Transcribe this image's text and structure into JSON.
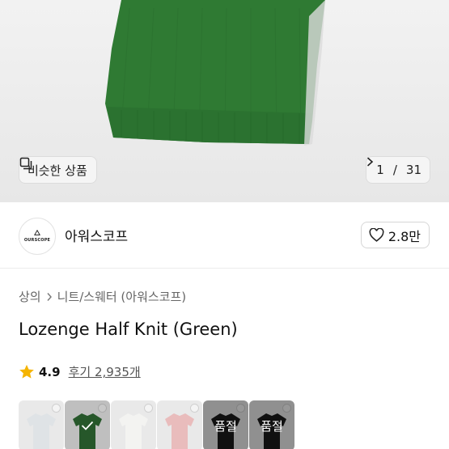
{
  "hero": {
    "similar_label": "비슷한 상품",
    "counter": {
      "current": "1",
      "separator": "/",
      "total": "31"
    }
  },
  "brand": {
    "logo_text": "OURSCOPE",
    "name": "아워스코프",
    "likes": "2.8만"
  },
  "breadcrumb": {
    "level1": "상의",
    "level2": "니트/스웨터 (아워스코프)"
  },
  "product": {
    "title": "Lozenge Half Knit (Green)",
    "rating": "4.9",
    "reviews_label": "후기 2,935개"
  },
  "swatches": [
    {
      "color": "#dfe3e6",
      "status": "",
      "selected": false
    },
    {
      "color": "#2f6b34",
      "status": "",
      "selected": true
    },
    {
      "color": "#f3f3f1",
      "status": "",
      "selected": false
    },
    {
      "color": "#e9bcbc",
      "status": "",
      "selected": false
    },
    {
      "color": "#1a1a1a",
      "status": "품절",
      "selected": false
    },
    {
      "color": "#1a1a1a",
      "status": "품절",
      "selected": false
    }
  ],
  "colors": {
    "knit_green": "#2e7d32",
    "star": "#f5b400",
    "brand_accent": "#111111"
  }
}
